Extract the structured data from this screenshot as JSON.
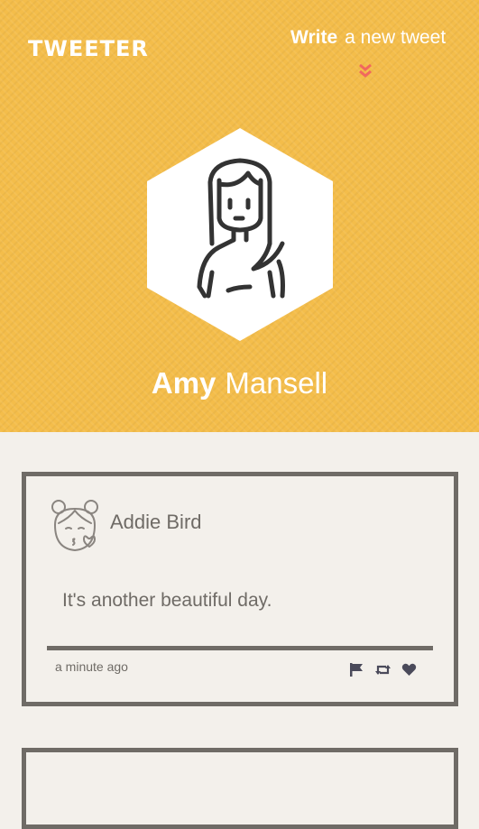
{
  "header": {
    "logo_text": "TWEETER",
    "write_strong": "Write",
    "write_light": "a new tweet",
    "chevron_icon": "double-chevron-down",
    "accent_color": "#f4bd4a",
    "chevron_color": "#f1685e"
  },
  "profile": {
    "first_name": "Amy",
    "last_name": "Mansell",
    "avatar_icon": "woman-portrait-icon"
  },
  "tweets": [
    {
      "author": "Addie Bird",
      "avatar_icon": "girl-kiss-heart-icon",
      "text": "It's another beautiful day.",
      "time": "a minute ago",
      "actions": [
        "flag-icon",
        "retweet-icon",
        "heart-icon"
      ]
    }
  ]
}
